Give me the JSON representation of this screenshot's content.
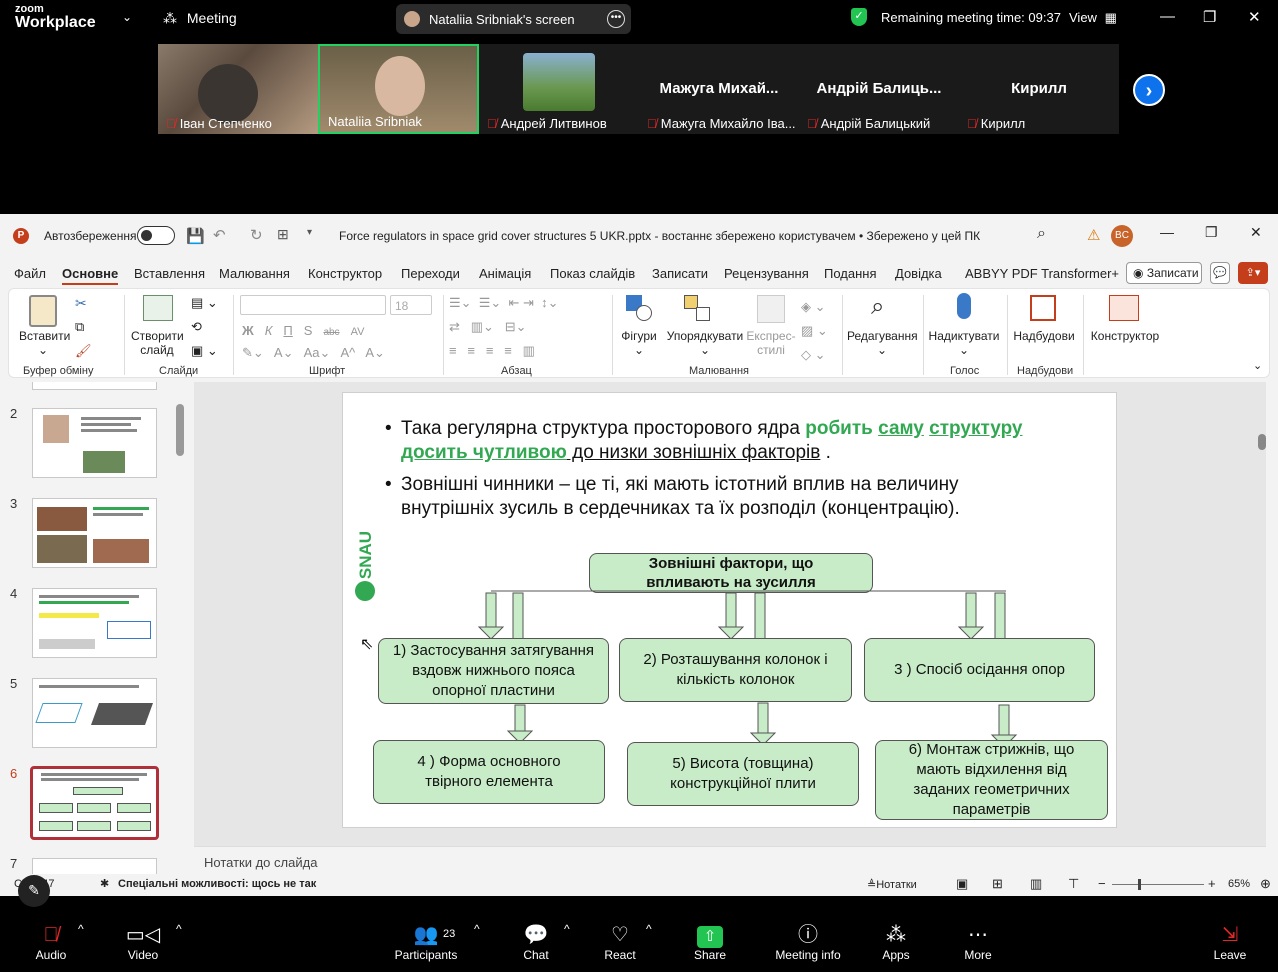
{
  "zoom": {
    "brand_top": "zoom",
    "brand_bottom": "Workplace",
    "meeting_label": "Meeting",
    "screen_share_label": "Nataliia Sribniak's screen",
    "remaining_time": "Remaining meeting time: 09:37",
    "view_label": "View",
    "participants": [
      {
        "name": "Іван Степченко",
        "muted": true
      },
      {
        "name": "Nataliia Sribniak",
        "muted": false
      },
      {
        "name": "Андрей Литвинов",
        "muted": true
      },
      {
        "name": "Мажуга Михайло Іва...",
        "display": "Мажуга  Михай...",
        "muted": true
      },
      {
        "name": "Андрій Балицький",
        "display": "Андрій  Балиць...",
        "muted": true
      },
      {
        "name": "Кирилл",
        "display": "Кирилл",
        "muted": true
      }
    ],
    "toolbar": {
      "audio": "Audio",
      "video": "Video",
      "participants": "Participants",
      "participants_count": "23",
      "chat": "Chat",
      "react": "React",
      "share": "Share",
      "meeting_info": "Meeting info",
      "apps": "Apps",
      "more": "More",
      "leave": "Leave"
    }
  },
  "ppt": {
    "autosave": "Автозбереження",
    "title": "Force regulators in space grid cover structures 5 UKR.pptx  -  востаннє збережено користувачем • Збережено у цей ПК",
    "user_initials": "BC",
    "menu": [
      "Файл",
      "Основне",
      "Вставлення",
      "Малювання",
      "Конструктор",
      "Переходи",
      "Анімація",
      "Показ слайдів",
      "Записати",
      "Рецензування",
      "Подання",
      "Довідка",
      "ABBYY PDF Transformer+"
    ],
    "record_button": "Записати",
    "ribbon": {
      "paste": "Вставити",
      "clipboard": "Буфер обміну",
      "new_slide": "Створити слайд",
      "slides": "Слайди",
      "font_size": "18",
      "font": "Шрифт",
      "paragraph": "Абзац",
      "shapes": "Фігури",
      "arrange": "Упорядкувати",
      "quick_styles": "Експрес-стилі",
      "drawing": "Малювання",
      "editing": "Редагування",
      "dictate": "Надиктувати",
      "voice": "Голос",
      "addins": "Надбудови",
      "addins_group": "Надбудови",
      "designer": "Конструктор",
      "font_buttons": [
        "Ж",
        "К",
        "П",
        "S",
        "abc",
        "AV"
      ]
    },
    "thumb_numbers": [
      "2",
      "3",
      "4",
      "5",
      "6",
      "7"
    ],
    "slide": {
      "logo": "SNAU",
      "bullet1_a": "Така регулярна структура просторового ядра ",
      "bullet1_b": "робить",
      "bullet1_c": "саму",
      "bullet1_d": "структуру досить чутливою",
      "bullet1_e": " до низки зовнішніх факторів",
      "bullet1_f": " .",
      "bullet2": "Зовнішні чинники – це ті, які мають істотний вплив на величину внутрішніх зусиль в сердечниках та їх розподіл (концентрацію).",
      "header_box": "Зовнішні фактори, що впливають на зусилля",
      "box1": "1) Застосування затягування вздовж нижнього пояса опорної пластини",
      "box2": "2) Розташування колонок і кількість колонок",
      "box3": "3 ) Спосіб осідання опор",
      "box4": "4 ) Форма основного твірного елемента",
      "box5": "5) Висота (товщина) конструкційної плити",
      "box6": "6) Монтаж стрижнів, що мають відхилення від заданих геометричних параметрів"
    },
    "notes_placeholder": "Нотатки до слайда",
    "status": {
      "slide_of": "С... з 47",
      "accessibility": "Спеціальні можливості: щось не так",
      "notes": "Нотатки",
      "zoom": "65%"
    }
  }
}
